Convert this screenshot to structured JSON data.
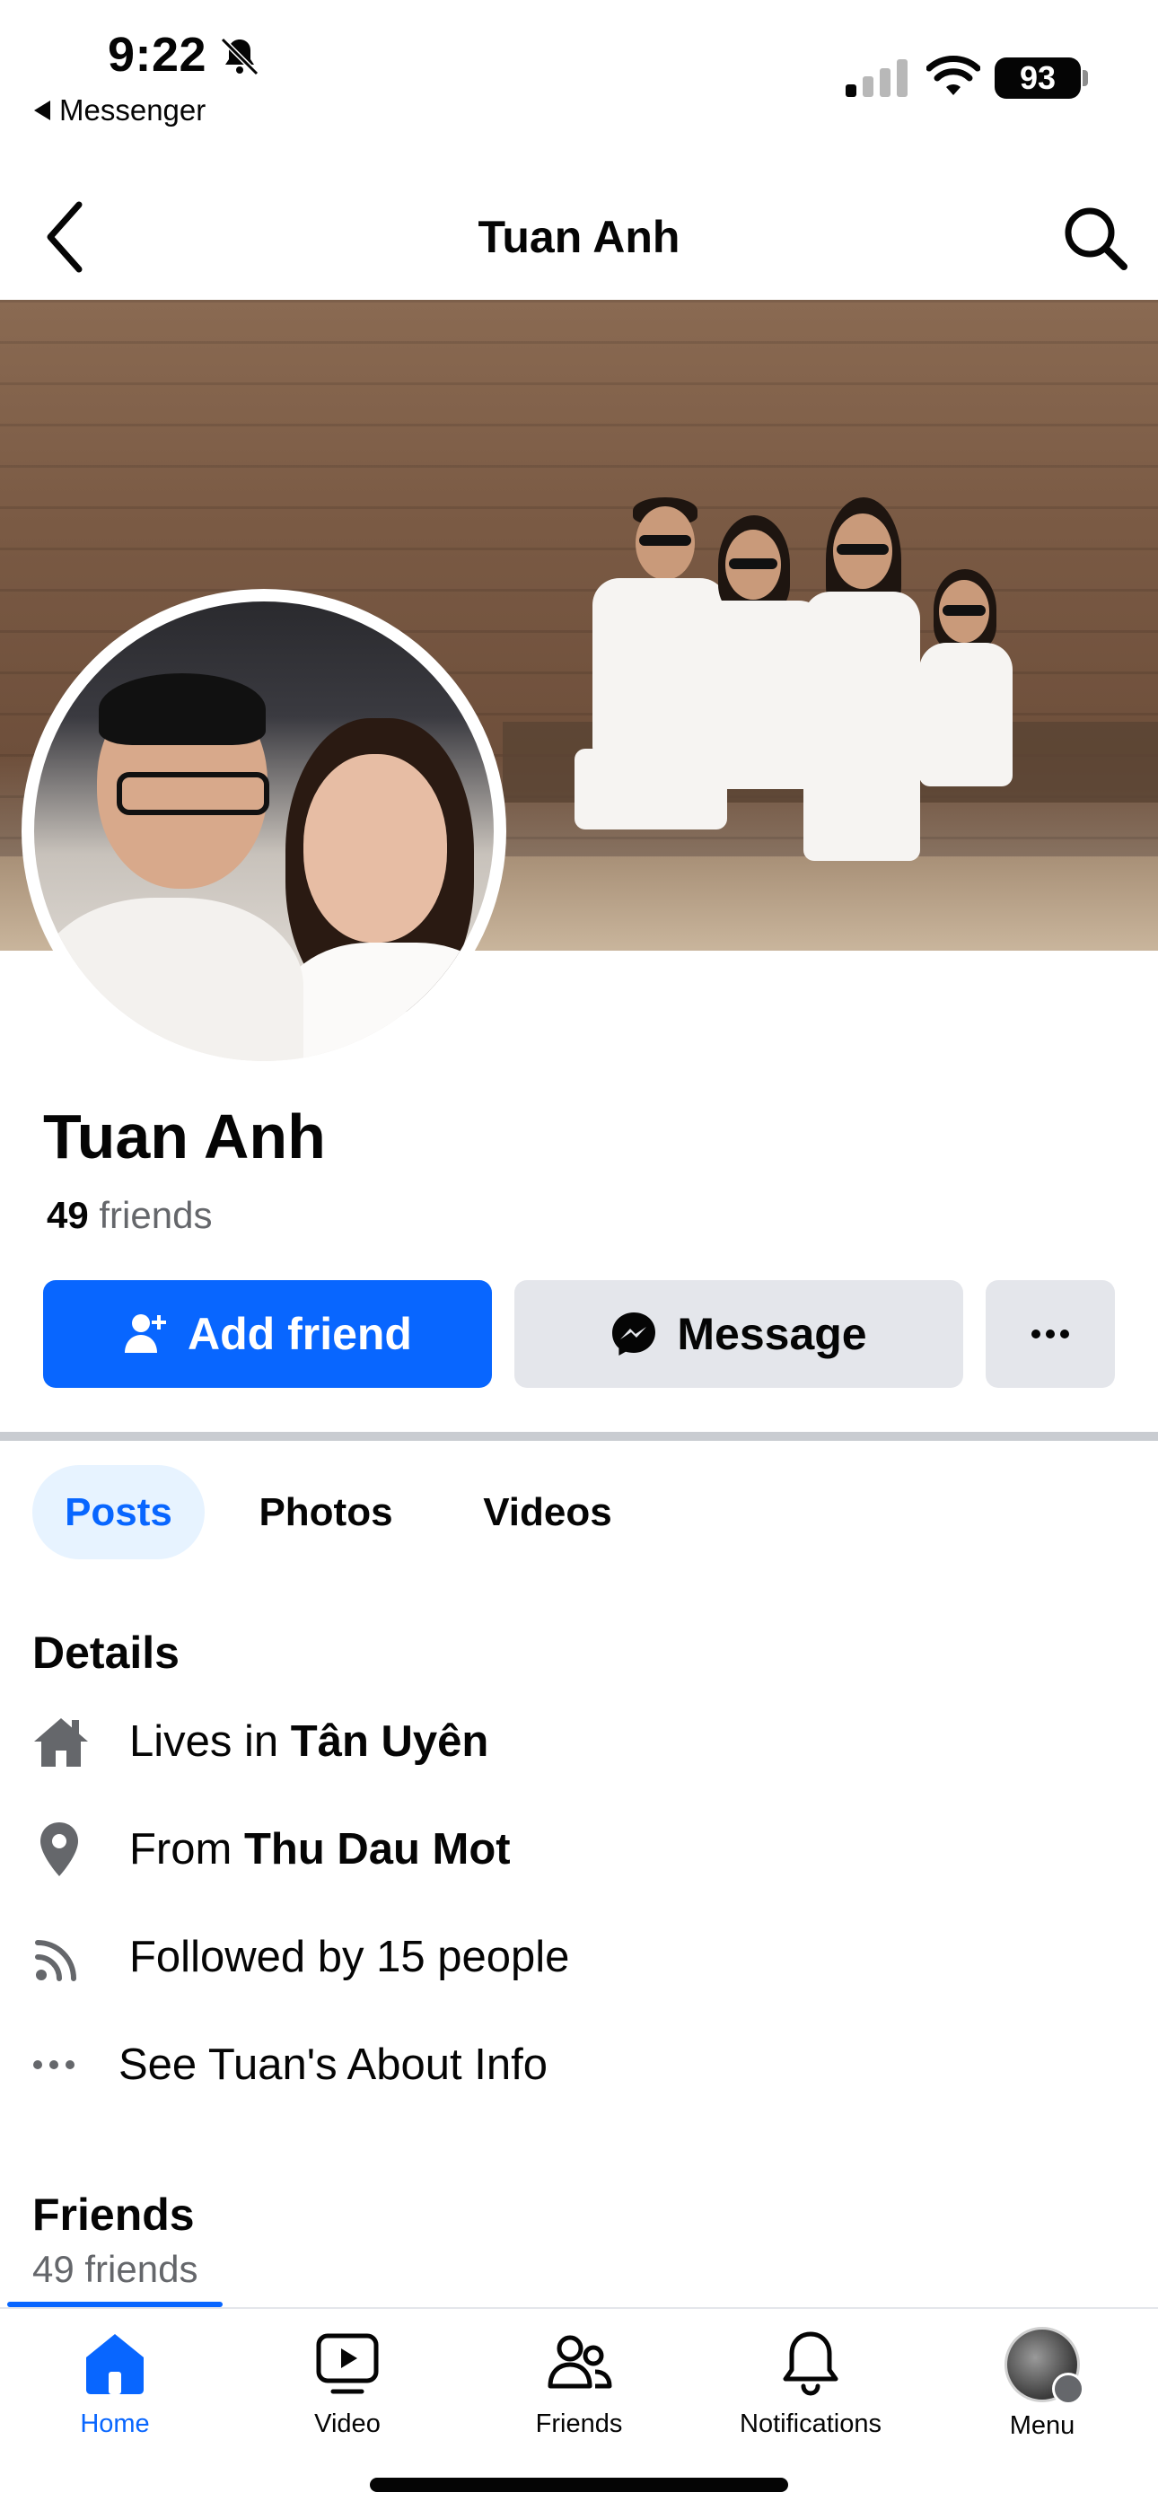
{
  "status_bar": {
    "time": "9:22",
    "back_app": "Messenger",
    "battery": "93"
  },
  "header": {
    "title": "Tuan Anh"
  },
  "profile": {
    "name": "Tuan Anh",
    "friends_number": "49",
    "friends_word": "friends"
  },
  "actions": {
    "add_friend": "Add friend",
    "message": "Message"
  },
  "tabs": [
    {
      "label": "Posts",
      "active": true
    },
    {
      "label": "Photos",
      "active": false
    },
    {
      "label": "Videos",
      "active": false
    }
  ],
  "details": {
    "title": "Details",
    "lives_prefix": "Lives in",
    "lives_place": "Tân Uyên",
    "from_prefix": "From",
    "from_place": "Thu Dau Mot",
    "followed": "Followed by 15 people",
    "about": "See Tuan's About Info"
  },
  "friends_section": {
    "title": "Friends",
    "count": "49 friends"
  },
  "bottom_nav": [
    {
      "label": "Home",
      "icon": "home-icon",
      "active": true
    },
    {
      "label": "Video",
      "icon": "video-icon",
      "active": false
    },
    {
      "label": "Friends",
      "icon": "friends-icon",
      "active": false
    },
    {
      "label": "Notifications",
      "icon": "bell-icon",
      "active": false
    },
    {
      "label": "Menu",
      "icon": "profile-avatar",
      "active": false
    }
  ],
  "colors": {
    "accent": "#0866ff",
    "button_gray": "#e4e6eb",
    "secondary_text": "#65676b",
    "active_tab_bg": "#e7f3ff"
  }
}
